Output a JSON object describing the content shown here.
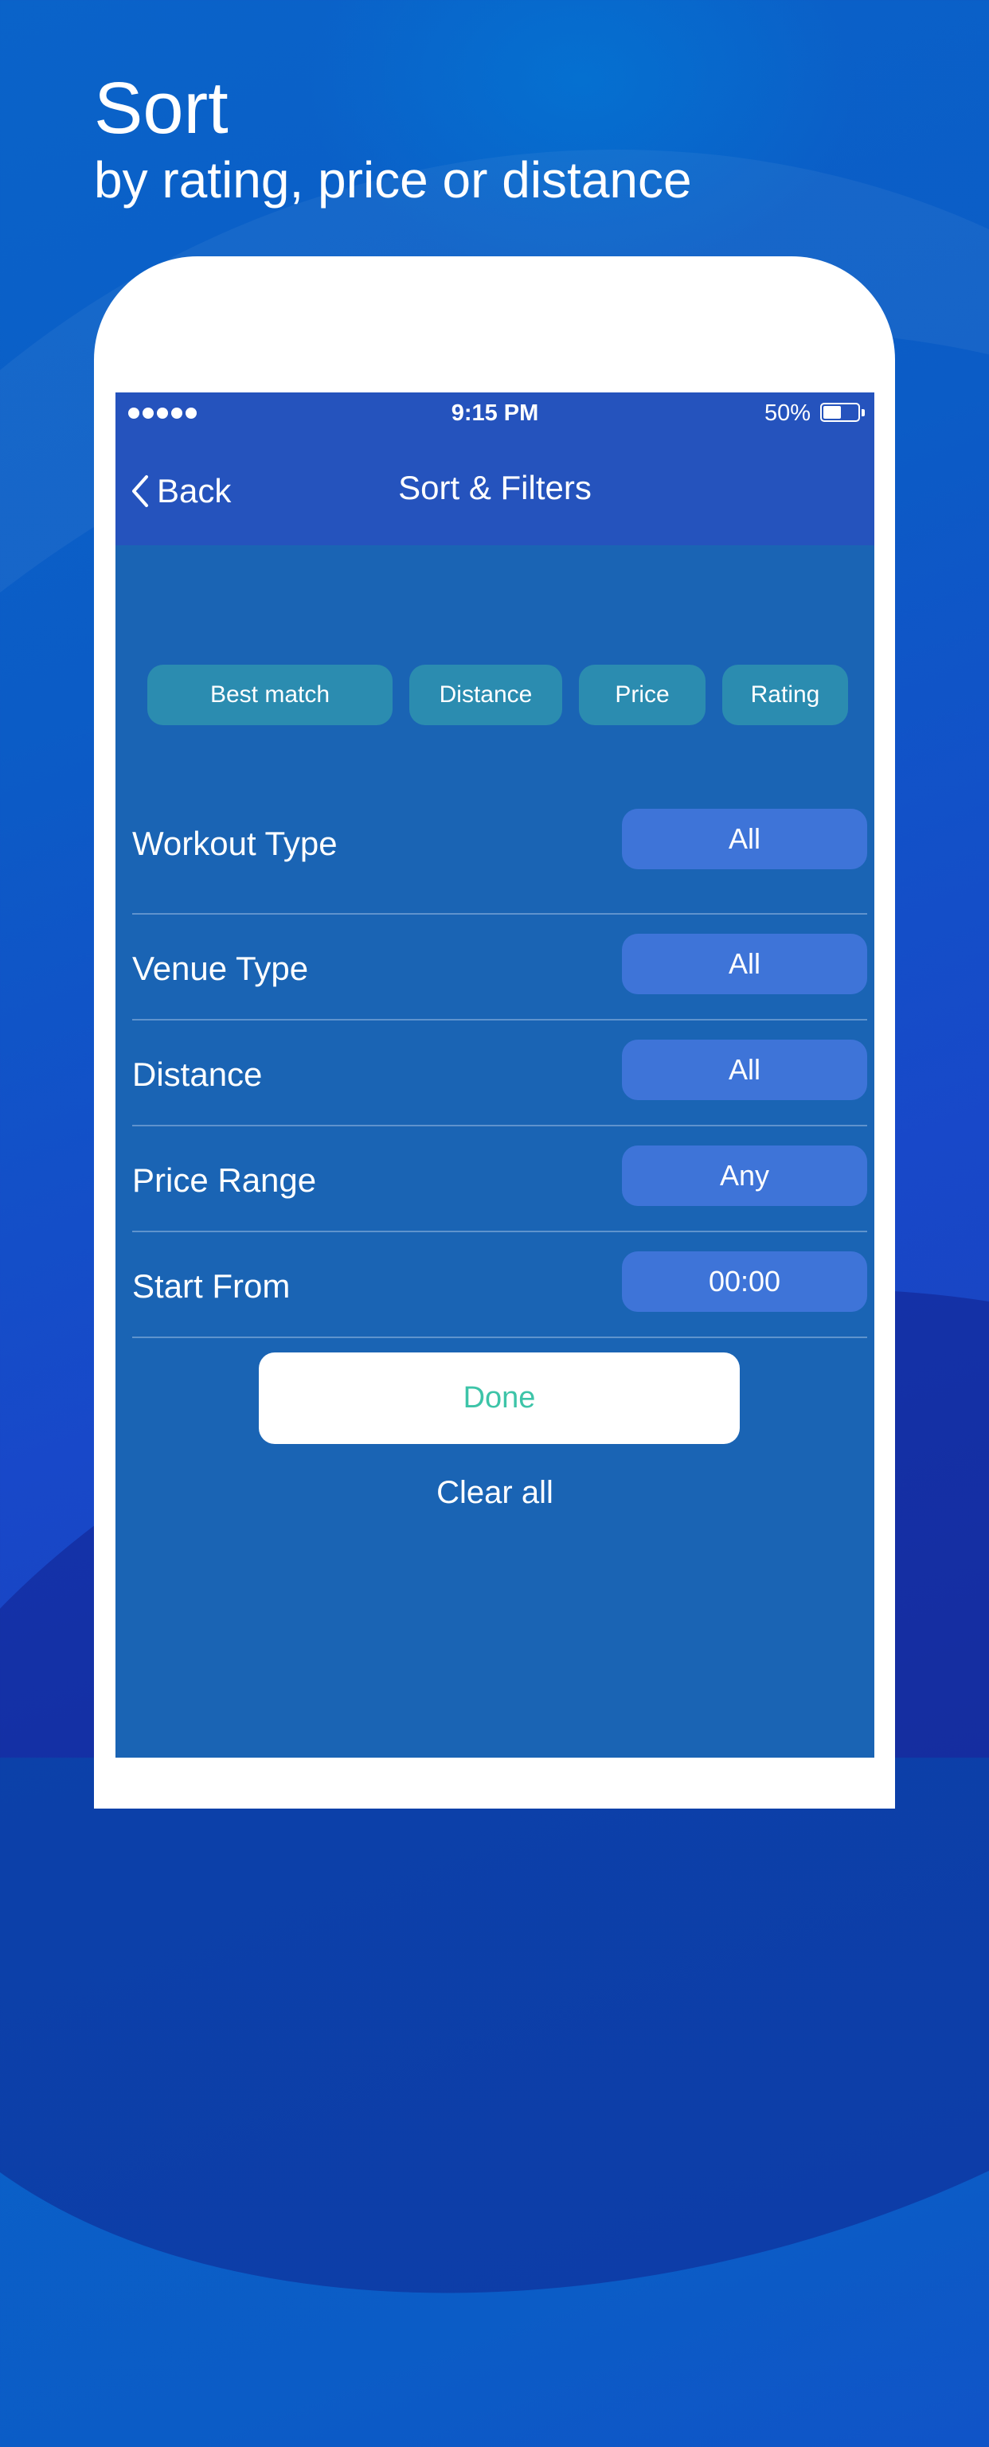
{
  "headline": {
    "title": "Sort",
    "subtitle": "by rating, price or distance"
  },
  "status_bar": {
    "time": "9:15 PM",
    "battery_percent": "50%",
    "signal_dots": 5,
    "battery_level": 0.5
  },
  "nav": {
    "back_label": "Back",
    "title": "Sort & Filters"
  },
  "sort_options": [
    "Best match",
    "Distance",
    "Price",
    "Rating"
  ],
  "filters": [
    {
      "label": "Workout Type",
      "value": "All"
    },
    {
      "label": "Venue Type",
      "value": "All"
    },
    {
      "label": "Distance",
      "value": "All"
    },
    {
      "label": "Price Range",
      "value": "Any"
    },
    {
      "label": "Start From",
      "value": "00:00"
    }
  ],
  "actions": {
    "done_label": "Done",
    "clear_label": "Clear all"
  },
  "colors": {
    "background": "#0b5cc6",
    "navbar": "#2553bd",
    "screen": "#1a64b4",
    "sort_pill": "#2b8cb0",
    "filter_pill": "#3e74d8",
    "done_text": "#3dc4a8"
  }
}
